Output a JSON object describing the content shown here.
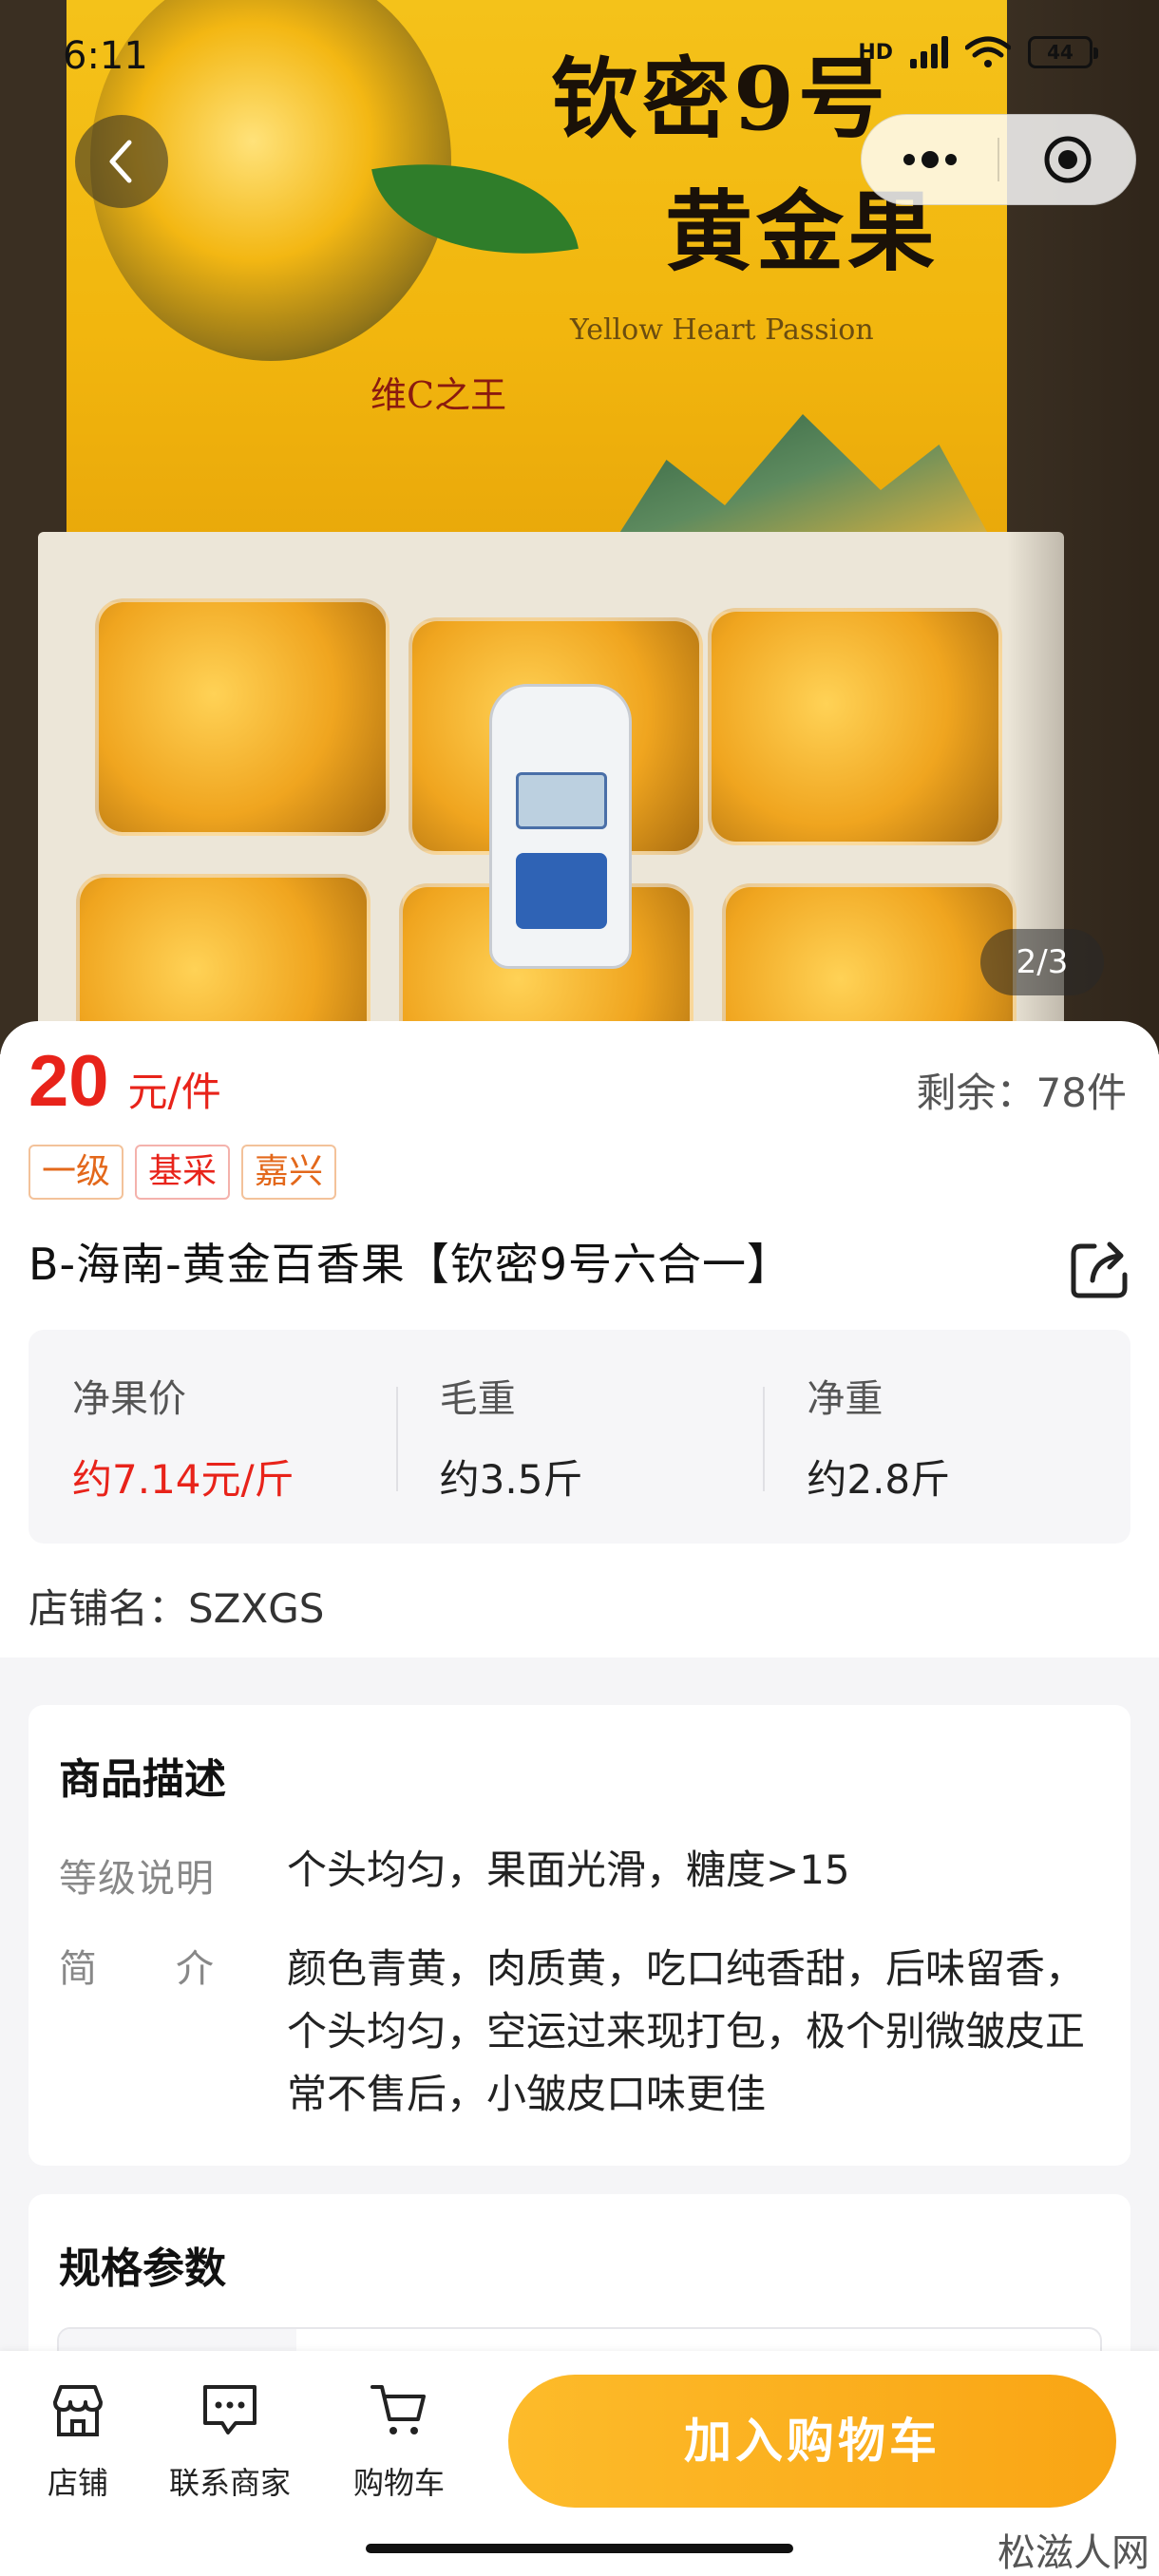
{
  "status_bar": {
    "time": "6:11",
    "network": "HD",
    "battery": "44"
  },
  "hero": {
    "brand_line_1": "钦密9号",
    "brand_line_2": "黄金果",
    "english_name": "Yellow Heart Passion",
    "slogan": "维C之王",
    "pager": "2/3"
  },
  "product": {
    "price": "20",
    "price_unit": "元/件",
    "stock": "剩余：78件",
    "tags": [
      "一级",
      "基采",
      "嘉兴"
    ],
    "title": "B-海南-黄金百香果【钦密9号六合一】",
    "weights": [
      {
        "label": "净果价",
        "value": "约7.14元/斤"
      },
      {
        "label": "毛重",
        "value": "约3.5斤"
      },
      {
        "label": "净重",
        "value": "约2.8斤"
      }
    ],
    "shop_name": "店铺名：SZXGS"
  },
  "description": {
    "title": "商品描述",
    "rows": [
      {
        "key": "等级说明",
        "value": "个头均匀，果面光滑，糖度>15"
      },
      {
        "key": "简　　介",
        "value": "颜色青黄，肉质黄，吃口纯香甜，后味留香，个头均匀，空运过来现打包，极个别微皱皮正常不售后，小皱皮口味更佳"
      }
    ]
  },
  "specs": {
    "title": "规格参数"
  },
  "bottom_bar": {
    "shop": "店铺",
    "contact": "联系商家",
    "cart": "购物车",
    "add_to_cart": "加入购物车"
  },
  "watermark": "松滋人网",
  "colors": {
    "price_red": "#e8231a",
    "accent_orange": "#f9a514",
    "tag_orange": "#e3681b"
  },
  "icons": [
    "back-icon",
    "more-icon",
    "close-target-icon",
    "share-icon",
    "store-icon",
    "chat-icon",
    "cart-icon"
  ]
}
